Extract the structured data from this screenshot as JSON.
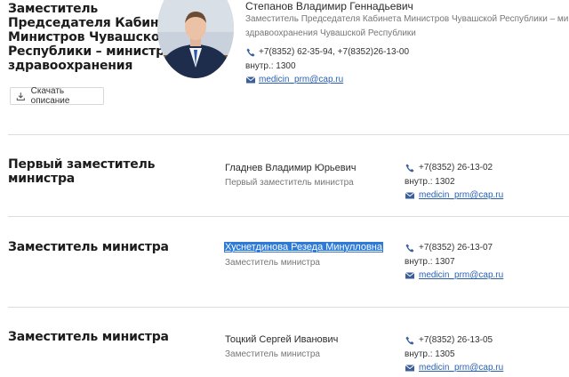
{
  "leader": {
    "section_title_lines": [
      "Заместитель",
      "Председателя Кабинета",
      "Министров Чувашской",
      "Республики – министр",
      "здравоохранения"
    ],
    "download_label": "Скачать описание",
    "name": "Степанов Владимир Геннадьевич",
    "position_lines": [
      "Заместитель Председателя Кабинета Министров Чувашской Республики – министр",
      "здравоохранения Чувашской Республики"
    ],
    "phone": "+7(8352) 62-35-94, +7(8352)26-13-00",
    "ext": "внутр.: 1300",
    "email": "medicin_prm@cap.ru"
  },
  "deputies": [
    {
      "section_title_lines": [
        "Первый заместитель",
        "министра"
      ],
      "name": "Гладнев Владимир Юрьевич",
      "position": "Первый заместитель министра",
      "phone": "+7(8352) 26-13-02",
      "ext": "внутр.: 1302",
      "email": "medicin_prm@cap.ru"
    },
    {
      "section_title_lines": [
        "Заместитель министра"
      ],
      "name": "Хуснетдинова Резеда Минулловна",
      "position": "Заместитель министра",
      "phone": "+7(8352) 26-13-07",
      "ext": "внутр.: 1307",
      "email": "medicin_prm@cap.ru"
    },
    {
      "section_title_lines": [
        "Заместитель министра"
      ],
      "name": "Тоцкий Сергей Иванович",
      "position": "Заместитель министра",
      "phone": "+7(8352) 26-13-05",
      "ext": "внутр.: 1305",
      "email": "medicin_prm@cap.ru"
    }
  ],
  "icons": {
    "phone": "phone-icon",
    "mail": "envelope-icon",
    "download": "download-icon"
  },
  "colors": {
    "link": "#2a5fb0",
    "icon": "#3c5f9a",
    "selection": "#2f7ad6"
  }
}
